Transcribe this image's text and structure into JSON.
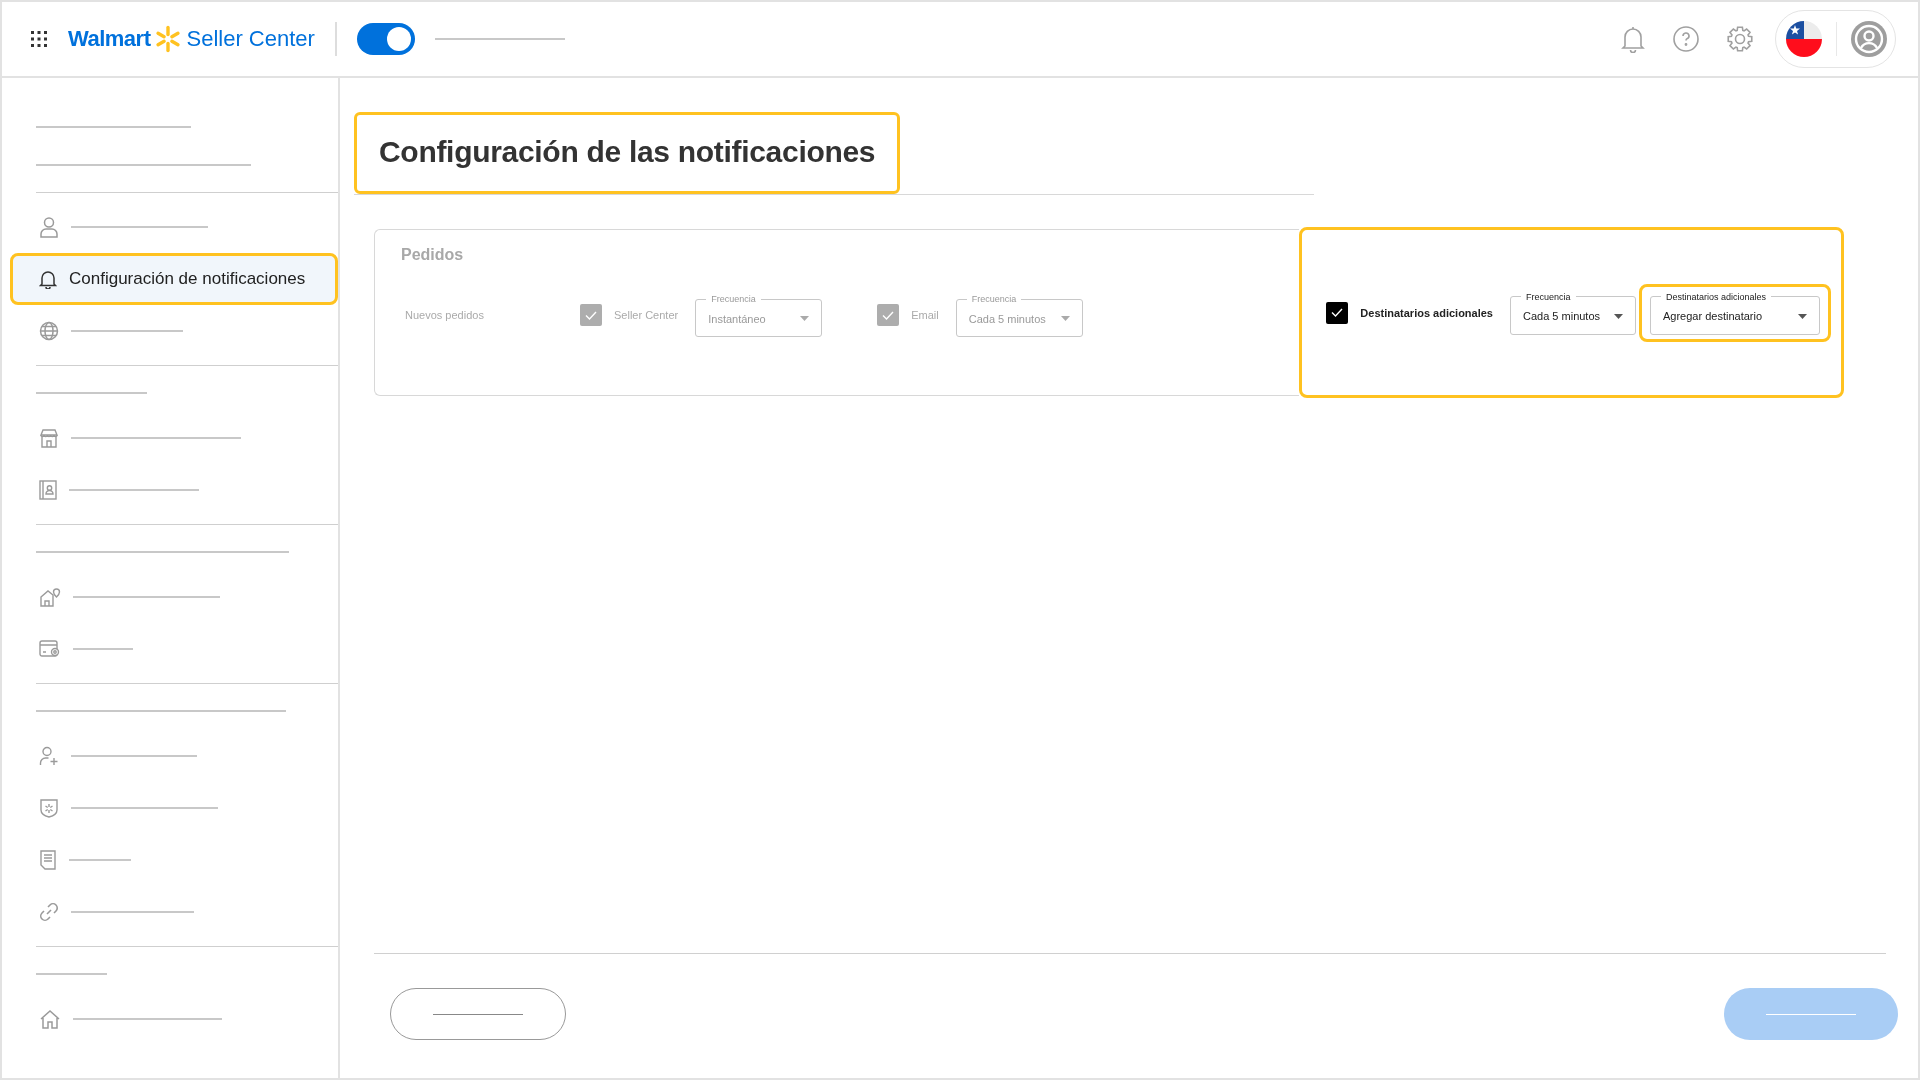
{
  "header": {
    "logo": {
      "brand": "Walmart",
      "product": "Seller Center"
    },
    "toggle": {
      "on": true
    }
  },
  "sidebar": {
    "groups": [
      {
        "items": [
          {
            "kind": "heading"
          },
          {
            "kind": "heading"
          }
        ]
      },
      {
        "items": [
          {
            "kind": "link",
            "selected": false,
            "highlighted": false
          },
          {
            "kind": "link",
            "label": "Configuración de notificaciones",
            "selected": true,
            "highlighted": true
          },
          {
            "kind": "link",
            "selected": false,
            "highlighted": false
          }
        ]
      },
      {
        "items": [
          {
            "kind": "heading"
          },
          {
            "kind": "link",
            "selected": false,
            "highlighted": false
          },
          {
            "kind": "link",
            "selected": false,
            "highlighted": false
          }
        ]
      },
      {
        "items": [
          {
            "kind": "heading"
          },
          {
            "kind": "link",
            "selected": false,
            "highlighted": false
          },
          {
            "kind": "link",
            "selected": false,
            "highlighted": false
          }
        ]
      },
      {
        "items": [
          {
            "kind": "heading"
          },
          {
            "kind": "link",
            "selected": false,
            "highlighted": false
          },
          {
            "kind": "link",
            "selected": false,
            "highlighted": false
          },
          {
            "kind": "link",
            "selected": false,
            "highlighted": false
          },
          {
            "kind": "link",
            "selected": false,
            "highlighted": false
          }
        ]
      },
      {
        "items": [
          {
            "kind": "heading"
          },
          {
            "kind": "link",
            "selected": false,
            "highlighted": false
          }
        ]
      }
    ]
  },
  "page": {
    "title": "Configuración de las notificaciones",
    "title_highlighted": true
  },
  "panel": {
    "title": "Pedidos",
    "row_label": "Nuevos pedidos",
    "channels": [
      {
        "label": "Seller Center",
        "checked": true,
        "disabled": true,
        "highlighted": false,
        "selects": [
          {
            "label": "Frecuencia",
            "value": "Instantáneo",
            "highlighted": false
          }
        ]
      },
      {
        "label": "Email",
        "checked": true,
        "disabled": true,
        "highlighted": false,
        "selects": [
          {
            "label": "Frecuencia",
            "value": "Cada 5 minutos",
            "highlighted": false
          }
        ]
      },
      {
        "label": "Destinatarios adicionales",
        "checked": true,
        "disabled": false,
        "highlighted": true,
        "selects": [
          {
            "label": "Frecuencia",
            "value": "Cada 5 minutos",
            "highlighted": false
          },
          {
            "label": "Destinatarios adicionales",
            "value": "Agregar destinatario",
            "highlighted": true
          }
        ]
      }
    ]
  }
}
